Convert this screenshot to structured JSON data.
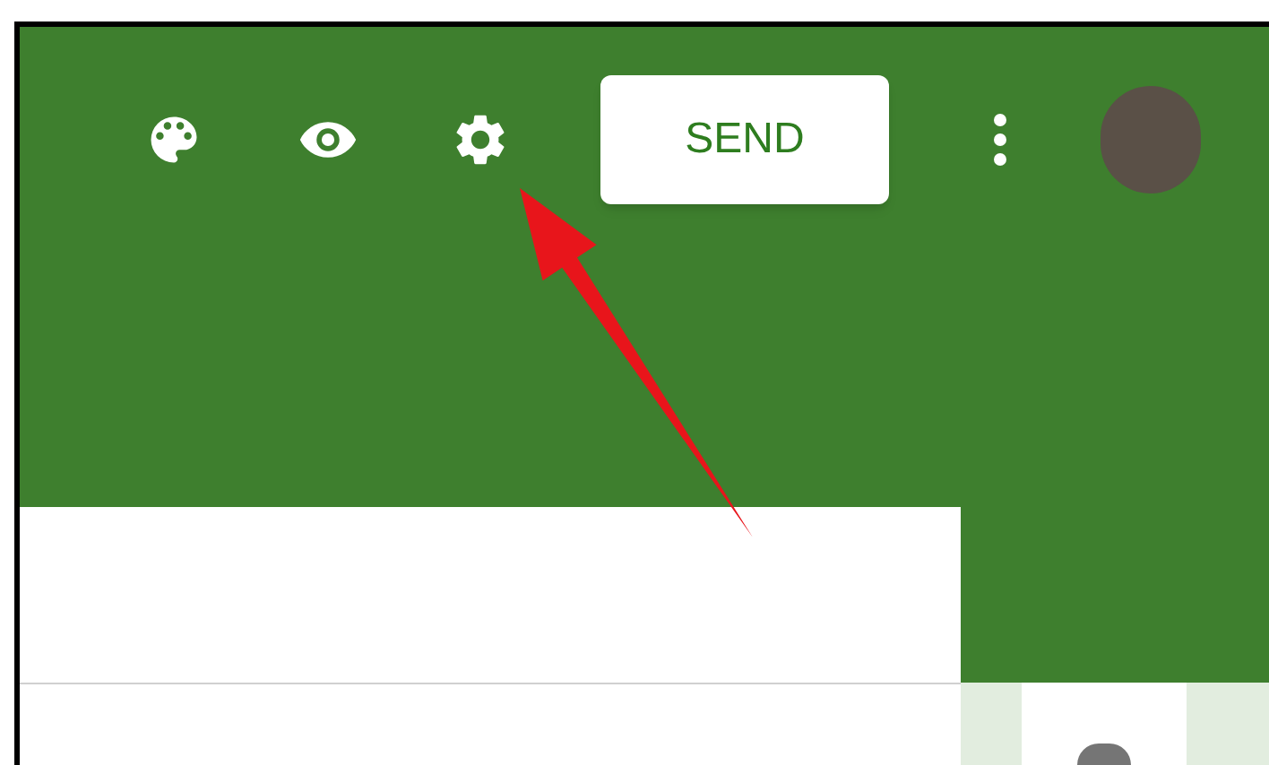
{
  "toolbar": {
    "send_button": "SEND"
  }
}
